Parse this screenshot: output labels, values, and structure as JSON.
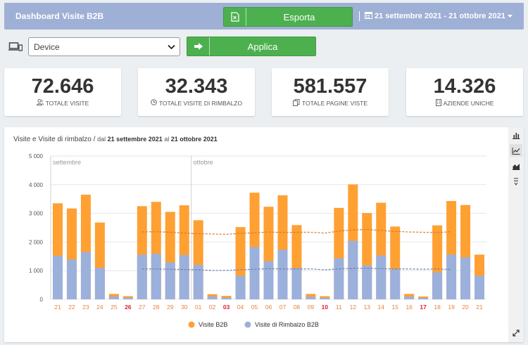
{
  "header": {
    "title": "Dashboard Visite B2B",
    "export_label": "Esporta",
    "date_range": "21 settembre 2021 - 21 ottobre 2021"
  },
  "filter": {
    "device_value": "Device",
    "apply_label": "Applica"
  },
  "kpis": [
    {
      "value": "72.646",
      "label": "TOTALE VISITE",
      "icon": "users-icon"
    },
    {
      "value": "32.343",
      "label": "TOTALE VISITE DI RIMBALZO",
      "icon": "clock-icon"
    },
    {
      "value": "581.557",
      "label": "TOTALE PAGINE VISTE",
      "icon": "pages-icon"
    },
    {
      "value": "14.326",
      "label": "AZIENDE UNICHE",
      "icon": "building-icon"
    }
  ],
  "chart": {
    "title": "Visite e Visite di rimbalzo /",
    "sub_dal": "dal",
    "sub_from": "21 settembre 2021",
    "sub_al": "al",
    "sub_to": "21 ottobre 2021"
  },
  "colors": {
    "visite": "#ffa033",
    "rimbalzo": "#9cb0dc",
    "weekend": "#e8202a",
    "day": "#e8833a"
  },
  "chart_data": {
    "type": "bar",
    "ylim": [
      0,
      5000
    ],
    "yticks": [
      "5 000",
      "4 000",
      "3 000",
      "2 000",
      "1 000",
      "0"
    ],
    "month_labels": [
      {
        "label": "settembre",
        "index": 0
      },
      {
        "label": "ottobre",
        "index": 10
      }
    ],
    "categories": [
      "21",
      "22",
      "23",
      "24",
      "25",
      "26",
      "27",
      "28",
      "29",
      "30",
      "01",
      "02",
      "03",
      "04",
      "05",
      "06",
      "07",
      "08",
      "09",
      "10",
      "11",
      "12",
      "13",
      "14",
      "15",
      "16",
      "17",
      "18",
      "19",
      "20",
      "21"
    ],
    "weekend": [
      false,
      false,
      false,
      false,
      false,
      true,
      false,
      false,
      false,
      false,
      false,
      false,
      true,
      false,
      false,
      false,
      false,
      false,
      false,
      true,
      false,
      false,
      false,
      false,
      false,
      false,
      true,
      false,
      false,
      false,
      false
    ],
    "series": [
      {
        "name": "Visite B2B",
        "values": [
          3350,
          3170,
          3650,
          2680,
          190,
          110,
          3250,
          3400,
          3050,
          3280,
          2760,
          180,
          120,
          2520,
          3720,
          3230,
          3630,
          2590,
          190,
          110,
          3190,
          4010,
          3010,
          3370,
          2540,
          190,
          100,
          2580,
          3430,
          3290,
          1560
        ]
      },
      {
        "name": "Visite di Rimbalzo B2B",
        "values": [
          1520,
          1390,
          1650,
          1100,
          100,
          55,
          1560,
          1590,
          1290,
          1540,
          1200,
          100,
          60,
          820,
          1820,
          1330,
          1730,
          1090,
          90,
          55,
          1430,
          2040,
          1180,
          1530,
          1050,
          95,
          50,
          940,
          1560,
          1460,
          820
        ]
      }
    ],
    "trend_visite": {
      "from_index": 6,
      "to_index": 28,
      "values": [
        2350,
        2360,
        2340,
        2310,
        2290,
        2280,
        2270,
        2300,
        2320,
        2350,
        2330,
        2340,
        2340,
        2310,
        2380,
        2420,
        2440,
        2400,
        2370,
        2350,
        2340,
        2330,
        2360
      ]
    },
    "trend_rimbalzo": {
      "from_index": 6,
      "to_index": 28,
      "values": [
        1060,
        1060,
        1050,
        1040,
        1030,
        1010,
        1010,
        1030,
        1050,
        1070,
        1060,
        1060,
        1060,
        1030,
        1060,
        1080,
        1080,
        1070,
        1060,
        1060,
        1050,
        1060,
        1040
      ]
    },
    "legend": [
      "Visite B2B",
      "Visite di Rimbalzo B2B"
    ]
  }
}
